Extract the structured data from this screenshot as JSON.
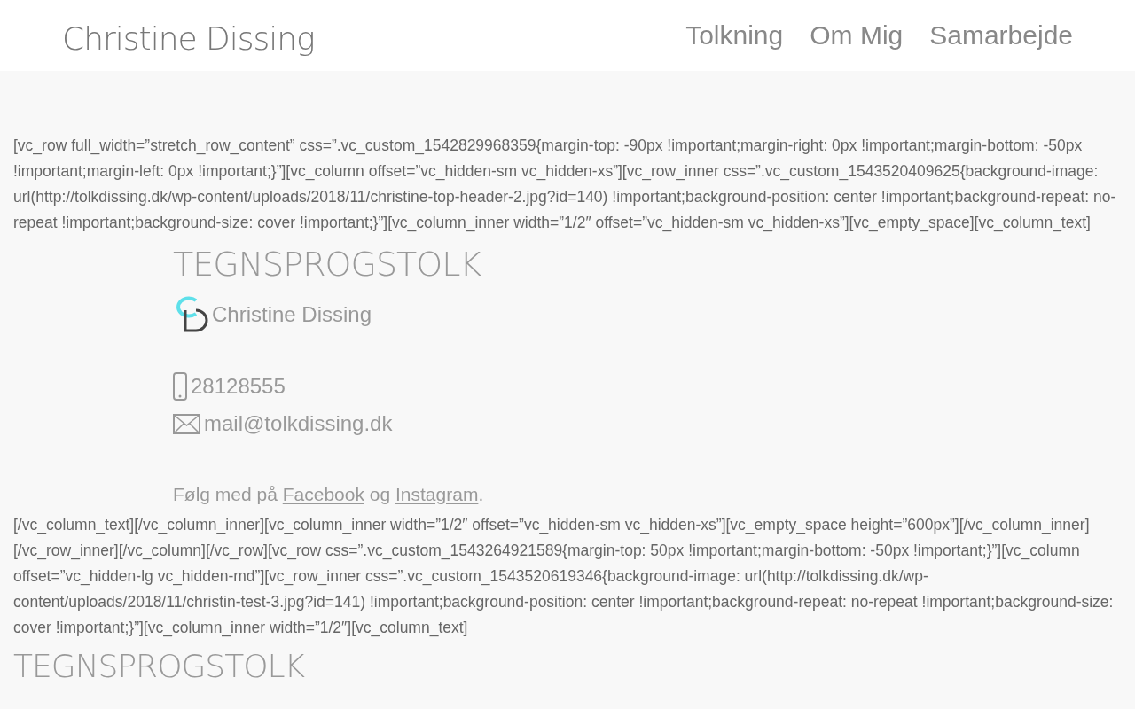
{
  "header": {
    "site_title": "Christine Dissing",
    "nav": [
      {
        "label": "Tolkning"
      },
      {
        "label": "Om Mig"
      },
      {
        "label": "Samarbejde"
      }
    ]
  },
  "content": {
    "shortcode_before": "[vc_row full_width=”stretch_row_content” css=”.vc_custom_1542829968359{margin-top: -90px !important;margin-right: 0px !important;margin-bottom: -50px !important;margin-left: 0px !important;}”][vc_column offset=”vc_hidden-sm vc_hidden-xs”][vc_row_inner css=”.vc_custom_1543520409625{background-image: url(http://tolkdissing.dk/wp-content/uploads/2018/11/christine-top-header-2.jpg?id=140) !important;background-position: center !important;background-repeat: no-repeat !important;background-size: cover !important;}”][vc_column_inner width=”1/2″ offset=”vc_hidden-sm vc_hidden-xs”][vc_empty_space][vc_column_text]",
    "hero": {
      "heading": "TEGNSPROGSTOLK",
      "logo_name": "Christine Dissing",
      "phone": "28128555",
      "email": "mail@tolkdissing.dk",
      "follow": {
        "before": "Følg med på",
        "link_1": "Facebook",
        "middle": "og",
        "link_2": "Instagram",
        "after": "."
      }
    },
    "shortcode_after": "[/vc_column_text][/vc_column_inner][vc_column_inner width=”1/2″ offset=”vc_hidden-sm vc_hidden-xs”][vc_empty_space height=”600px”][/vc_column_inner][/vc_row_inner][/vc_column][/vc_row][vc_row css=”.vc_custom_1543264921589{margin-top: 50px !important;margin-bottom: -50px !important;}”][vc_column offset=”vc_hidden-lg vc_hidden-md”][vc_row_inner css=”.vc_custom_1543520619346{background-image: url(http://tolkdissing.dk/wp-content/uploads/2018/11/christin-test-3.jpg?id=141) !important;background-position: center !important;background-repeat: no-repeat !important;background-size: cover !important;}”][vc_column_inner width=”1/2″][vc_column_text]",
    "second_heading": "TEGNSPROGSTOLK"
  }
}
